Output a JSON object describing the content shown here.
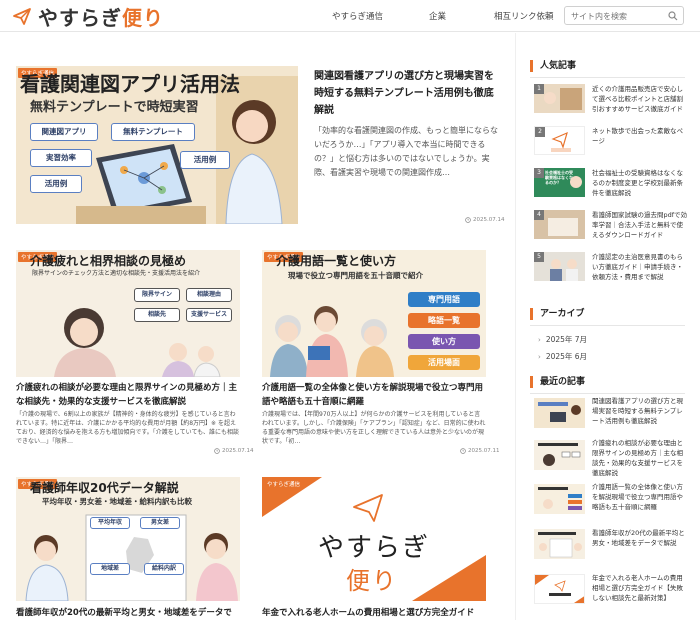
{
  "header": {
    "logo_text_a": "やすらぎ",
    "logo_text_b": "便り",
    "nav": [
      "やすらぎ通信",
      "企業",
      "相互リンク依頼"
    ],
    "search_placeholder": "サイト内を検索"
  },
  "colors": {
    "accent": "#e8732c",
    "link_blue": "#5a7fc2"
  },
  "feature": {
    "tag": "やすらぎ通信",
    "image_headline": "看護関連図アプリ活用法",
    "image_subhead": "無料テンプレートで時短実習",
    "image_boxes": [
      "関連図アプリ",
      "無料テンプレート",
      "実習効率",
      "活用例",
      "活用例"
    ],
    "title": "関連図看護アプリの選び方と現場実習を時短する無料テンプレート活用例も徹底解説",
    "excerpt": "「効率的な看護関連図の作成、もっと簡単にならないだろうか…」「アプリ導入で本当に時間できるの？」と悩む方は多いのではないでしょうか。実際、看護実習や現場での関連図作成…",
    "date": "2025.07.14"
  },
  "cards": [
    {
      "tag": "やすらぎ通信",
      "image_headline": "介護疲れと相界相談の見極め",
      "image_subhead": "限界サインのチェック方法と適切な相談先・支援活用法を紹介",
      "image_boxes": [
        "限界サイン",
        "相談理由",
        "相談先",
        "支援サービス"
      ],
      "title": "介護疲れの相談が必要な理由と限界サインの見極め方｜主な相談先・効果的な支援サービスを徹底解説",
      "excerpt": "「介護の現場で、6割以上の家族が【精神的・身体的な疲労】を感じていると言われています。特に近年は、介護にかかる平均的な費用が月額【約8万円】※ を超えており、経済的な悩みを抱える方も増加傾向です。「介護をしていても、誰にも相談できない…」「限界…",
      "date": "2025.07.14"
    },
    {
      "tag": "やすらぎ通信",
      "image_headline": "介護用語一覧と使い方",
      "image_subhead": "現場で役立つ専門用語を五十音順で紹介",
      "image_pills": [
        "専門用語",
        "略語一覧",
        "使い方",
        "活用場面"
      ],
      "title": "介護用語一覧の全体像と使い方を解説現場で役立つ専門用語や略語も五十音順に網羅",
      "excerpt": "介護現場では、【年間970万人以上】が何らかの介護サービスを利用していると言われています。しかし、「介護保険」「ケアプラン」「認知症」など、日常的に使われる重要な専門用語の意味や使い方を正しく理解できている人は意外と少ないのが現状です。「初…",
      "date": "2025.07.11"
    },
    {
      "tag": "やすらぎ通信",
      "image_headline": "看護師年収20代データ解説",
      "image_subhead": "平均年収・男女差・地域差・給料内訳も比較",
      "image_boxes": [
        "平均年収",
        "男女差",
        "地域差",
        "給料内訳"
      ],
      "title": "看護師年収が20代の最新平均と男女・地域差をデータで解説"
    },
    {
      "tag": "やすらぎ通信",
      "image_logo_a": "やすらぎ",
      "image_logo_b": "便り",
      "title": "年金で入れる老人ホームの費用相場と選び方完全ガイド"
    }
  ],
  "sidebar": {
    "popular_heading": "人気記事",
    "popular": [
      {
        "rank": "1",
        "title": "近くの介護用品販売店で安心して選べる比較ポイントと店舗割引おすすめサービス徹底ガイド"
      },
      {
        "rank": "2",
        "title": "ネット散歩で出会った素敵なページ"
      },
      {
        "rank": "3",
        "title": "社会福祉士の受験資格はなくなるのか制度変更と学校別最新条件を徹底解説",
        "thumb_text": "社会福祉士の受験資格はなくなるのか？"
      },
      {
        "rank": "4",
        "title": "看護師国家試験の過去問pdfで効率学習｜合法入手法と無料で使えるダウンロードガイド"
      },
      {
        "rank": "5",
        "title": "介護認定の主治医意見書のもらい方徹底ガイド｜申請手続き・依頼方法・費用まで解説"
      }
    ],
    "archive_heading": "アーカイブ",
    "archive": [
      "2025年 7月",
      "2025年 6月"
    ],
    "recent_heading": "最近の記事",
    "recent": [
      {
        "title": "関連図看護アプリの選び方と現場実習を時短する無料テンプレート活用例も徹底解説"
      },
      {
        "title": "介護疲れの相談が必要な理由と限界サインの見極め方｜主な相談先・効果的な支援サービスを徹底解説"
      },
      {
        "title": "介護用語一覧の全体像と使い方を解説現場で役立つ専門用語や略語も五十音順に網羅"
      },
      {
        "title": "看護師年収が20代の最新平均と男女・地域差をデータで解説"
      },
      {
        "title": "年金で入れる老人ホームの費用相場と選び方完全ガイド【失敗しない相談先と最新対策】"
      }
    ]
  }
}
